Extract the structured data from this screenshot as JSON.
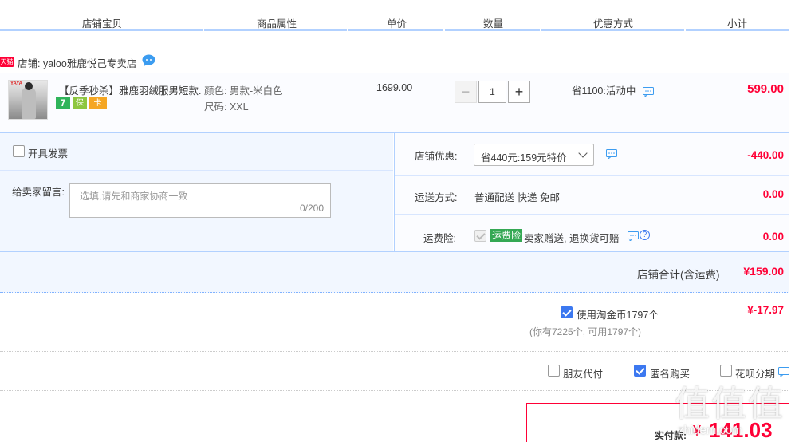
{
  "header": {
    "columns": [
      "店铺宝贝",
      "商品属性",
      "单价",
      "数量",
      "优惠方式",
      "小计"
    ]
  },
  "shop": {
    "badge": "天猫",
    "name": "店铺: yaloo雅鹿悦己专卖店"
  },
  "item": {
    "title": "【反季秒杀】雅鹿羽绒服男短款...",
    "thumb_tag": "YAYA",
    "service_icons": [
      "7",
      "保",
      "卡"
    ],
    "sku_color": "颜色: 男款-米白色",
    "sku_size": "尺码: XXL",
    "unit_price": "1699.00",
    "quantity": "1",
    "qty_minus": "−",
    "qty_plus": "+",
    "promo": "省1100:活动中",
    "subtotal": "599.00"
  },
  "options": {
    "invoice_label": "开具发票",
    "message_label": "给卖家留言:",
    "message_placeholder": "选填,请先和商家协商一致",
    "message_count": "0/200",
    "shop_discount_label": "店铺优惠:",
    "shop_discount_value": "省440元:159元特价",
    "shop_discount_amount": "-440.00",
    "delivery_label": "运送方式:",
    "delivery_value": "普通配送 快递 免邮",
    "delivery_amount": "0.00",
    "insurance_label": "运费险:",
    "insurance_tag": "运费险",
    "insurance_text": "卖家赠送, 退换货可赔",
    "insurance_help": "?",
    "insurance_amount": "0.00"
  },
  "shop_total": {
    "label": "店铺合计(含运费)",
    "value": "¥159.00"
  },
  "coins": {
    "label": "使用淘金币1797个",
    "sub": "(你有7225个, 可用1797个)",
    "amount": "¥-17.97",
    "checked": true
  },
  "checkout_options": [
    {
      "label": "朋友代付",
      "checked": false
    },
    {
      "label": "匿名购买",
      "checked": true
    },
    {
      "label": "花呗分期",
      "checked": false
    }
  ],
  "payment": {
    "label": "实付款:",
    "currency": "¥",
    "value": "141.03"
  },
  "watermark": {
    "text": "值值值",
    "sub": "zhidem.com"
  },
  "colors": {
    "accent_red": "#ff0036",
    "accent_blue": "#3c78f0",
    "header_bar": "#b2d1ff",
    "green_tag": "#34a853"
  }
}
